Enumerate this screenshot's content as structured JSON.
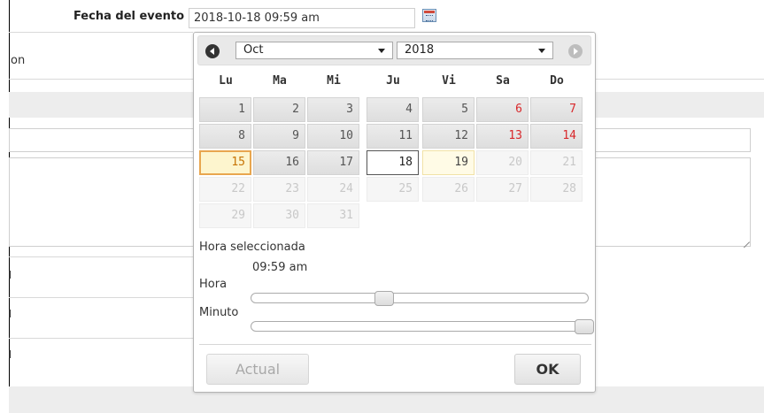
{
  "form": {
    "event_date_label": "Fecha del evento",
    "event_date_value": "2018-10-18 09:59 am",
    "truncated_row_text": "on"
  },
  "datepicker": {
    "month_select": {
      "selected": "Oct"
    },
    "year_select": {
      "selected": "2018"
    },
    "weekdays": [
      "Lu",
      "Ma",
      "Mi",
      "Ju",
      "Vi",
      "Sa",
      "Do"
    ],
    "weeks": [
      [
        "1",
        "2",
        "3",
        "4",
        "5",
        "6",
        "7"
      ],
      [
        "8",
        "9",
        "10",
        "11",
        "12",
        "13",
        "14"
      ],
      [
        "15",
        "16",
        "17",
        "18",
        "19",
        "20",
        "21"
      ],
      [
        "22",
        "23",
        "24",
        "25",
        "26",
        "27",
        "28"
      ],
      [
        "29",
        "30",
        "31"
      ]
    ],
    "selected_day": "18",
    "today_day": "15",
    "time": {
      "selected_label": "Hora seleccionada",
      "selected_value": "09:59 am",
      "hour_label": "Hora",
      "minute_label": "Minuto",
      "hour_slider_fraction": 0.39,
      "minute_slider_fraction": 1.0
    },
    "buttons": {
      "now": "Actual",
      "ok": "OK"
    }
  },
  "colors": {
    "weekend_red": "#d8282b",
    "today_highlight": "#fdf5ce",
    "header_gray": "#e9e9e9"
  }
}
